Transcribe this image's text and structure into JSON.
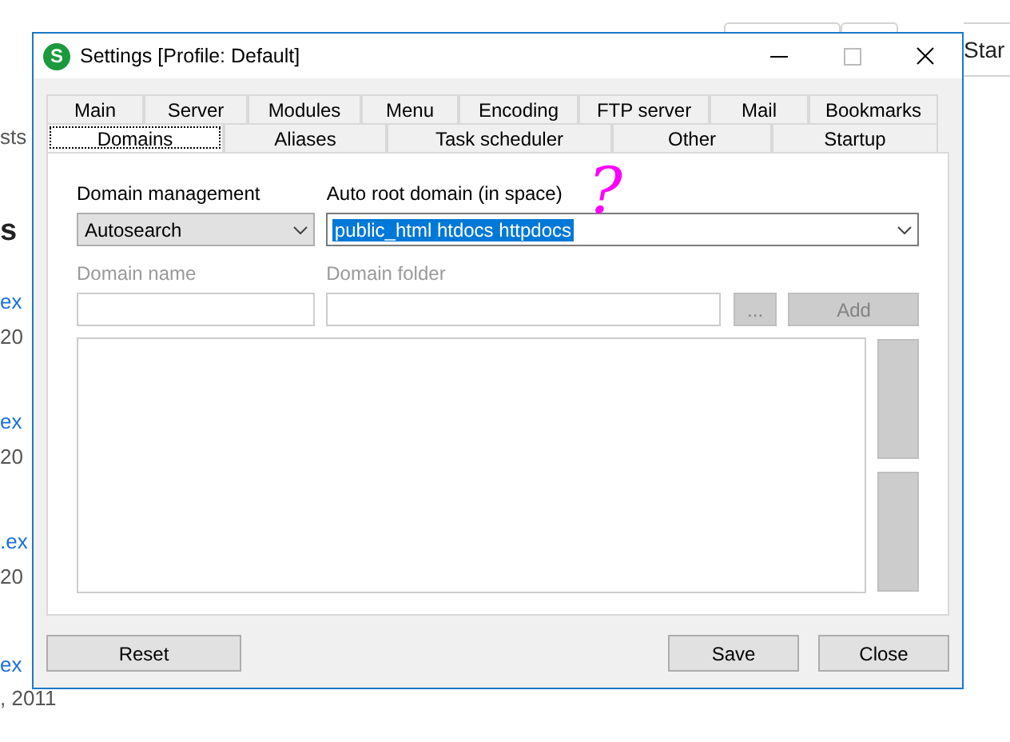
{
  "background_page": {
    "texts": [
      {
        "text": "sts",
        "kind": "plain"
      },
      {
        "text": "s",
        "kind": "heading"
      },
      {
        "text": "ex",
        "kind": "link"
      },
      {
        "text": "20",
        "kind": "plain"
      },
      {
        "text": "ex",
        "kind": "link"
      },
      {
        "text": "20",
        "kind": "plain"
      },
      {
        "text": ".ex",
        "kind": "link"
      },
      {
        "text": "20",
        "kind": "plain"
      },
      {
        "text": "ex",
        "kind": "link"
      },
      {
        "text": ", 2011",
        "kind": "plain"
      }
    ],
    "star_button": "Star"
  },
  "window": {
    "title": "Settings [Profile: Default]",
    "app_icon_letter": "S"
  },
  "tab_rows": [
    [
      {
        "label": "Main",
        "selected": false
      },
      {
        "label": "Server",
        "selected": false
      },
      {
        "label": "Modules",
        "selected": false
      },
      {
        "label": "Menu",
        "selected": false
      },
      {
        "label": "Encoding",
        "selected": false
      },
      {
        "label": "FTP server",
        "selected": false
      },
      {
        "label": "Mail",
        "selected": false
      },
      {
        "label": "Bookmarks",
        "selected": false
      }
    ],
    [
      {
        "label": "Domains",
        "selected": true
      },
      {
        "label": "Aliases",
        "selected": false
      },
      {
        "label": "Task scheduler",
        "selected": false
      },
      {
        "label": "Other",
        "selected": false
      },
      {
        "label": "Startup",
        "selected": false
      }
    ]
  ],
  "domain_management": {
    "label": "Domain management",
    "value": "Autosearch"
  },
  "auto_root_domain": {
    "label": "Auto root domain (in space)",
    "value": "public_html htdocs httpdocs",
    "highlighted": true
  },
  "domain_name": {
    "label": "Domain name",
    "disabled": true
  },
  "domain_folder": {
    "label": "Domain folder",
    "disabled": true
  },
  "browse_button": {
    "label": "...",
    "disabled": true
  },
  "add_button": {
    "label": "Add",
    "disabled": true
  },
  "side_buttons": [
    {
      "disabled": true
    },
    {
      "disabled": true
    }
  ],
  "annotation": "?",
  "buttons": {
    "left": [
      "Reset"
    ],
    "right": [
      "Save",
      "Close"
    ]
  }
}
